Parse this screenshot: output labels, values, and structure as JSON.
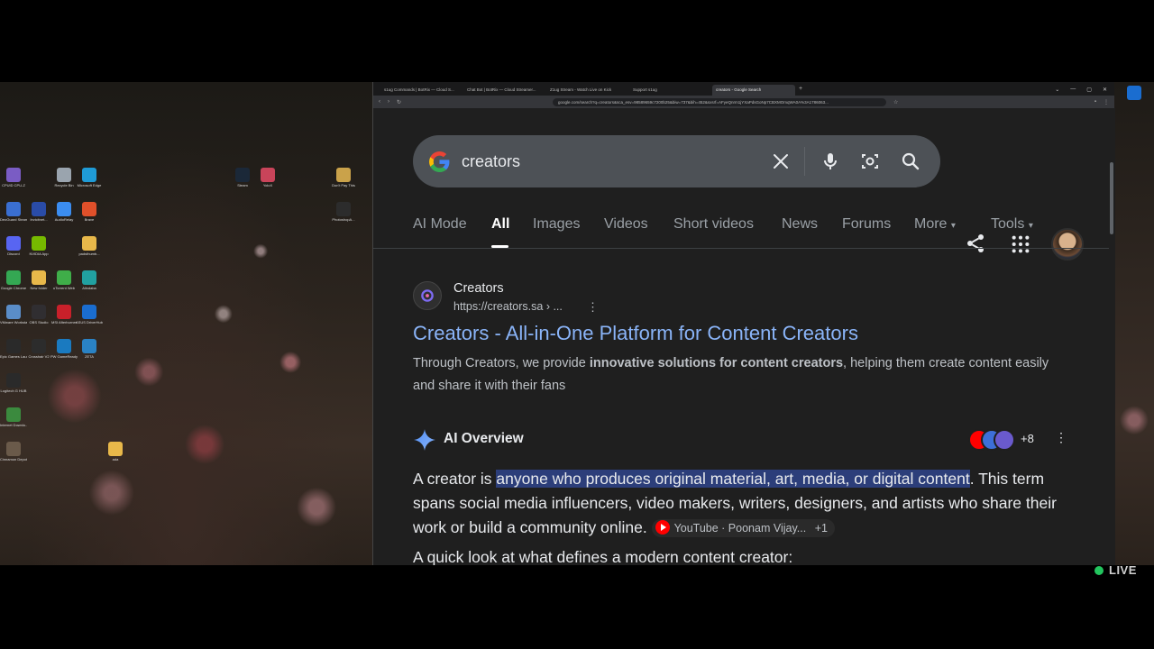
{
  "desktop": {
    "icons": [
      {
        "label": "CPUID CPU-Z",
        "color": "#7a5cc4"
      },
      {
        "label": "Recycle Bin",
        "color": "#9aa4ae"
      },
      {
        "label": "Microsoft Edge",
        "color": "#1f9bd6"
      },
      {
        "label": "Steam",
        "color": "#1b2838"
      },
      {
        "label": "YoloX",
        "color": "#c9445a"
      },
      {
        "label": "Don't Pay This",
        "color": "#caa24a"
      },
      {
        "label": "DeoGuard Steam E...",
        "color": "#3a6fd1"
      },
      {
        "label": "Invicitnet...",
        "color": "#2a4ca8"
      },
      {
        "label": "AudioRelay",
        "color": "#3b8df0"
      },
      {
        "label": "Brave",
        "color": "#e0502a"
      },
      {
        "label": "PhotoshopA...",
        "color": "#2c2c2c"
      },
      {
        "label": "Discord",
        "color": "#5865f2"
      },
      {
        "label": "NVIDIA App",
        "color": "#76b900"
      },
      {
        "label": "padsthumb...",
        "color": "#e8b84a"
      },
      {
        "label": "Google Chrome",
        "color": "#34a853"
      },
      {
        "label": "New folder",
        "color": "#e8b84a"
      },
      {
        "label": "uTorrent Web",
        "color": "#3fae49"
      },
      {
        "label": "Alindaba",
        "color": "#21a0a0"
      },
      {
        "label": "VMware Workstati...",
        "color": "#5a8dc8"
      },
      {
        "label": "OBS Studio",
        "color": "#302e31"
      },
      {
        "label": "MSI Afterburner",
        "color": "#c8202a"
      },
      {
        "label": "ASUS DriverHub",
        "color": "#1a6dd0"
      },
      {
        "label": "Epic Games Launcher",
        "color": "#2a2a2a"
      },
      {
        "label": "Crosshair V2",
        "color": "#2c2c2c"
      },
      {
        "label": "PW GameReady",
        "color": "#1a7ac0"
      },
      {
        "label": "ZETA",
        "color": "#2a82c4"
      },
      {
        "label": "Logitech G HUB",
        "color": "#2a2a2a"
      },
      {
        "label": "Internet Downlo...",
        "color": "#3b8a3e"
      },
      {
        "label": "Cinnamon Depot",
        "color": "#6a5a4a"
      },
      {
        "label": "ada",
        "color": "#e8b84a"
      }
    ]
  },
  "browser": {
    "tabs": [
      {
        "label": "s1ug Commands | BotRix — Cloud S..."
      },
      {
        "label": "Chat Bot | BotRix — Cloud Streamer..."
      },
      {
        "label": "Z1ug Stream - Watch Live on Kick"
      },
      {
        "label": "Support s1ug"
      },
      {
        "label": "creators - Google Search"
      }
    ],
    "new_tab": "+",
    "window_controls": [
      "⌄",
      "—",
      "▢",
      "✕"
    ],
    "url": "google.com/search?q=creators&sca_esv=98589659c7200b25&biw=737&bih=452&sxsrf=AFyeQnrm1jYXaPdsGoNp7CBXMOmqWA0A%3A1786063..."
  },
  "search": {
    "query": "creators",
    "tabs": [
      "AI Mode",
      "All",
      "Images",
      "Videos",
      "Short videos",
      "News",
      "Forums",
      "More",
      "Tools"
    ],
    "active_tab": "All"
  },
  "result": {
    "site_name": "Creators",
    "site_url": "https://creators.sa › ...",
    "more": "⋮",
    "title": "Creators - All-in-One Platform for Content Creators",
    "snippet_pre": "Through Creators, we provide ",
    "snippet_bold": "innovative solutions for content creators",
    "snippet_post": ", helping them create content easily and share it with their fans"
  },
  "ai_overview": {
    "title": "AI Overview",
    "sources_count": "+8",
    "more": "⋮",
    "text_pre": "A creator is ",
    "text_highlight": "anyone who produces original material, art, media, or digital content",
    "text_post": ". This term spans social media influencers, video makers, writers, designers, and artists who share their work or build a community online.",
    "citation": "YouTube · Poonam Vijay...",
    "citation_more": "+1",
    "next_line": "A quick look at what defines a modern content creator:"
  },
  "overlay": {
    "live_label": "LIVE"
  }
}
